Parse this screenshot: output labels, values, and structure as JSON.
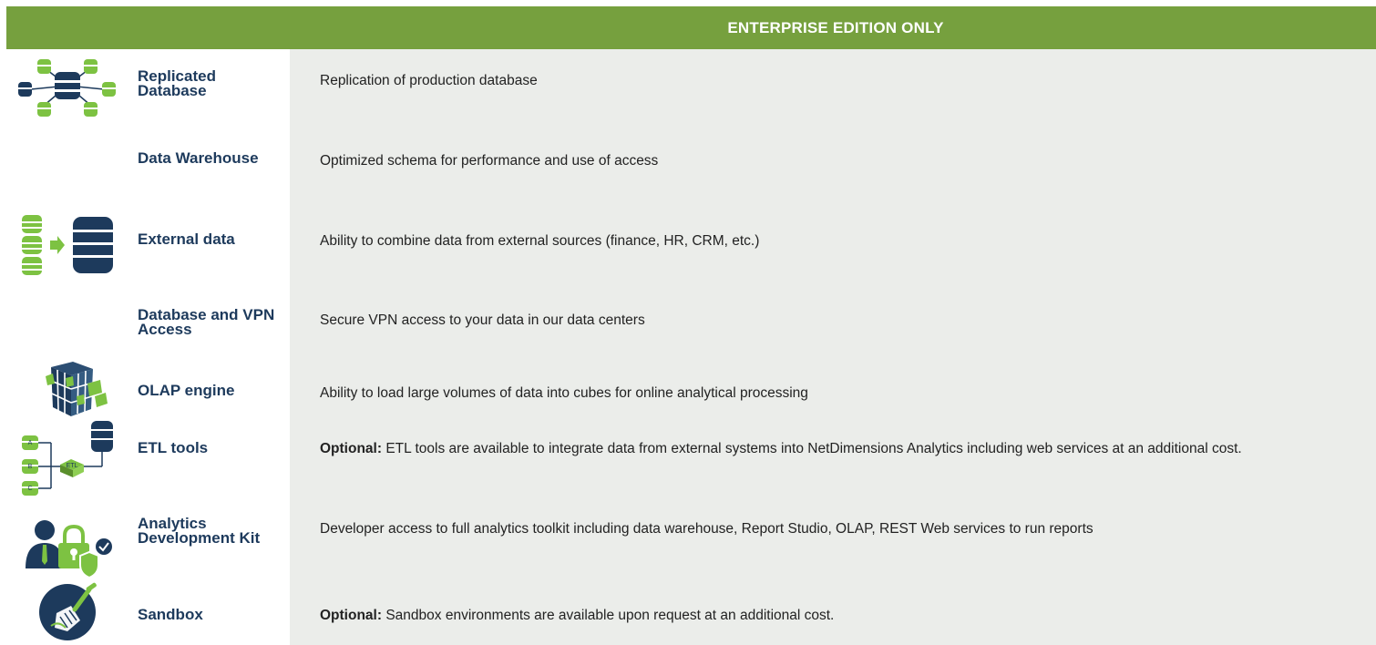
{
  "header": {
    "title": "ENTERPRISE EDITION ONLY"
  },
  "colors": {
    "header_green": "#76a03e",
    "label_navy": "#1d3a5c",
    "desc_bg": "#ebedea",
    "icon_green": "#7dc242",
    "icon_navy": "#1d3a5c"
  },
  "rows": [
    {
      "icon": "replicated-database-icon",
      "label": "Replicated Database",
      "desc_prefix": "",
      "desc": "Replication of production database"
    },
    {
      "icon": "",
      "label": "Data Warehouse",
      "desc_prefix": "",
      "desc": "Optimized schema for performance and use of access"
    },
    {
      "icon": "external-data-icon",
      "label": "External data",
      "desc_prefix": "",
      "desc": "Ability to combine data from external sources (finance, HR, CRM, etc.)"
    },
    {
      "icon": "",
      "label": "Database and VPN Access",
      "desc_prefix": "",
      "desc": "Secure VPN access to your data in our data centers"
    },
    {
      "icon": "olap-cube-icon",
      "label": "OLAP engine",
      "desc_prefix": "",
      "desc": "Ability to load large volumes of data into cubes for online analytical processing"
    },
    {
      "icon": "etl-tools-icon",
      "icon_letters": [
        "A",
        "B",
        "C",
        "ETL"
      ],
      "label": "ETL tools",
      "desc_prefix": "Optional:",
      "desc": " ETL tools are available to integrate data from external systems into NetDimensions Analytics including web services at an additional cost."
    },
    {
      "icon": "developer-lock-icon",
      "label": "Analytics Development Kit",
      "desc_prefix": "",
      "desc": "Developer access to full analytics toolkit including data warehouse, Report Studio, OLAP, REST Web services to run reports"
    },
    {
      "icon": "sandbox-shovel-icon",
      "label": "Sandbox",
      "desc_prefix": "Optional:",
      "desc": " Sandbox environments are available upon request at an additional cost."
    }
  ]
}
